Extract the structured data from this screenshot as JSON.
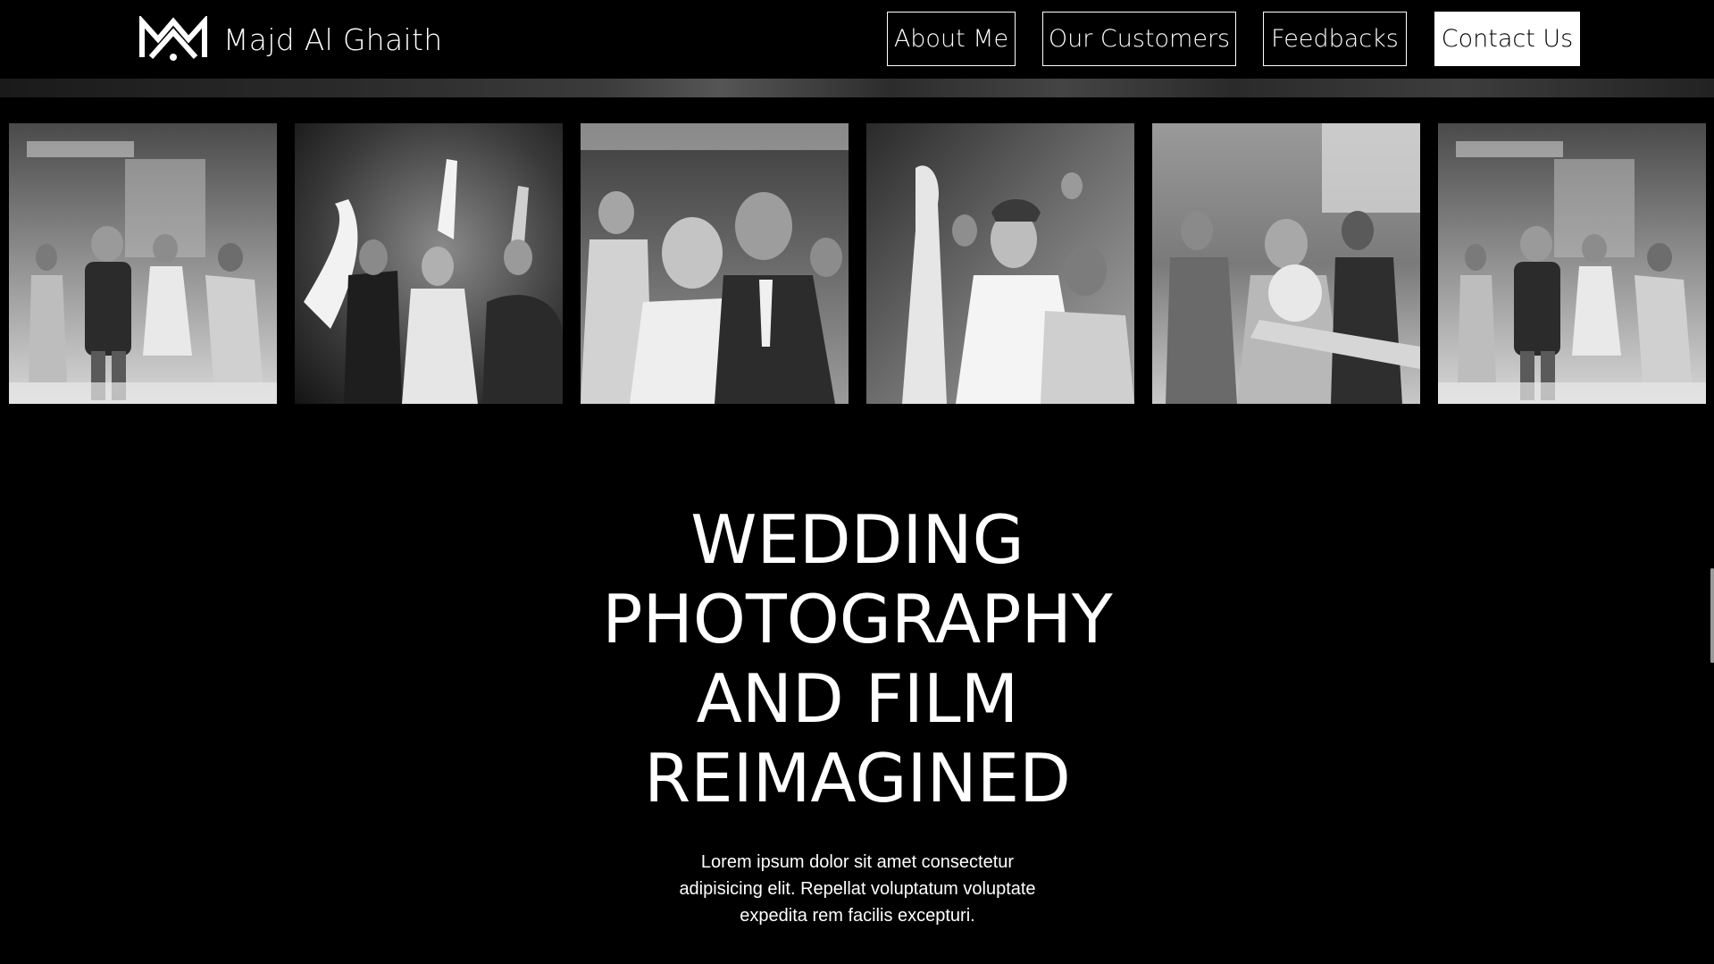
{
  "brand": {
    "name": "Majd Al Ghaith",
    "logo_icon": "mag-monogram-logo"
  },
  "nav": {
    "about_label": "About Me",
    "customers_label": "Our Customers",
    "feedbacks_label": "Feedbacks",
    "contact_label": "Contact Us"
  },
  "gallery": {
    "photos": [
      {
        "alt": "Guests dancing at a wedding reception"
      },
      {
        "alt": "Guests celebrating with raised hands"
      },
      {
        "alt": "Groom embracing a smiling guest"
      },
      {
        "alt": "Bride dancing among guests"
      },
      {
        "alt": "Guests dancing around the bride"
      },
      {
        "alt": "Guests dancing at a wedding reception"
      }
    ]
  },
  "hero": {
    "title_lines": [
      "WEDDING",
      "PHOTOGRAPHY",
      "AND FILM",
      "REIMAGINED"
    ],
    "description": "Lorem ipsum dolor sit amet consectetur adipisicing elit. Repellat voluptatum voluptate expedita rem facilis excepturi."
  },
  "colors": {
    "background": "#000000",
    "foreground": "#ffffff"
  }
}
